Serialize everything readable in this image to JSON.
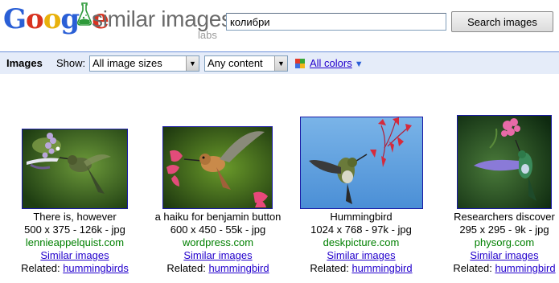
{
  "header": {
    "logo_text": "Google",
    "product_name": "similar images",
    "labs": "labs",
    "search_value": "колибри",
    "search_button": "Search images"
  },
  "filterbar": {
    "title": "Images",
    "show_label": "Show:",
    "size_selected": "All image sizes",
    "content_selected": "Any content",
    "colors_label": "All colors",
    "colors_arrow": "▼"
  },
  "results": [
    {
      "title": "There is, however",
      "meta": "500 x 375 - 126k - jpg",
      "domain": "lennieappelquist.com",
      "similar": "Similar images",
      "related_label": "Related:",
      "related_link": "hummingbirds"
    },
    {
      "title": "a haiku for benjamin button",
      "meta": "600 x 450 - 55k - jpg",
      "domain": "wordpress.com",
      "similar": "Similar images",
      "related_label": "Related:",
      "related_link": "hummingbird"
    },
    {
      "title": "Hummingbird",
      "meta": "1024 x 768 - 97k - jpg",
      "domain": "deskpicture.com",
      "similar": "Similar images",
      "related_label": "Related:",
      "related_link": "hummingbird"
    },
    {
      "title": "Researchers discover",
      "meta": "295 x 295 - 9k - jpg",
      "domain": "physorg.com",
      "similar": "Similar images",
      "related_label": "Related:",
      "related_link": "hummingbird"
    }
  ],
  "colors": {
    "link": "#2200cc",
    "domain": "#008000",
    "filterbar_bg": "#e5ecf9",
    "thumb_border": "#1a1aa6"
  }
}
